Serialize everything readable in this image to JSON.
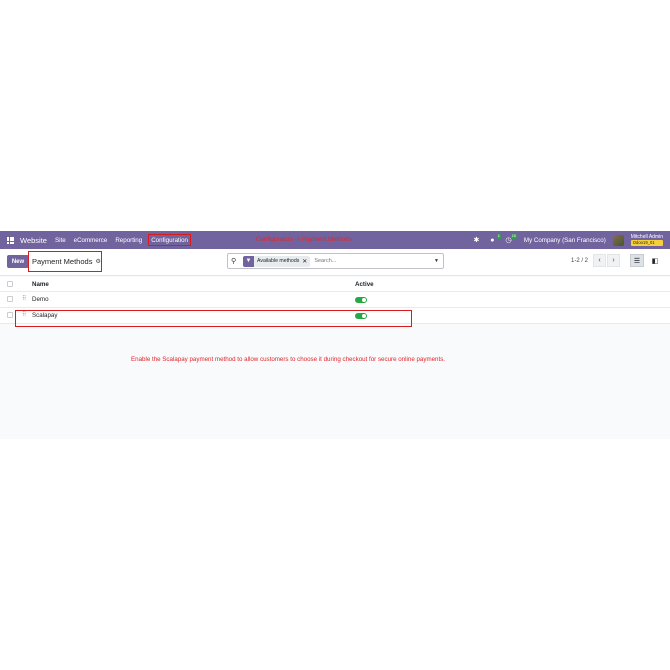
{
  "navbar": {
    "brand": "Website",
    "menu": [
      "Site",
      "eCommerce",
      "Reporting",
      "Configuration"
    ],
    "icons": [
      "apps-grid-icon",
      "bug-icon",
      "chat-icon",
      "clock-icon"
    ],
    "chat_badge": "1",
    "activity_badge": "10",
    "company": "My Company (San Francisco)",
    "user": {
      "name": "Mitchell Admin",
      "db": "Odoo19_01"
    }
  },
  "annotations": {
    "top": "Configuration -> Payment Methods",
    "main": "Enable the Scalapay payment method to allow customers to choose it during checkout for secure online payments."
  },
  "control": {
    "new_label": "New",
    "title": "Payment Methods",
    "search": {
      "facet": "Available methods",
      "placeholder": "Search..."
    },
    "pager": "1-2 / 2"
  },
  "table": {
    "columns": [
      "Name",
      "Active"
    ],
    "rows": [
      {
        "name": "Demo",
        "active": true
      },
      {
        "name": "Scalapay",
        "active": true
      }
    ]
  },
  "colors": {
    "brand": "#71639e",
    "annotation": "#e0262d",
    "toggle_on": "#28a745"
  }
}
